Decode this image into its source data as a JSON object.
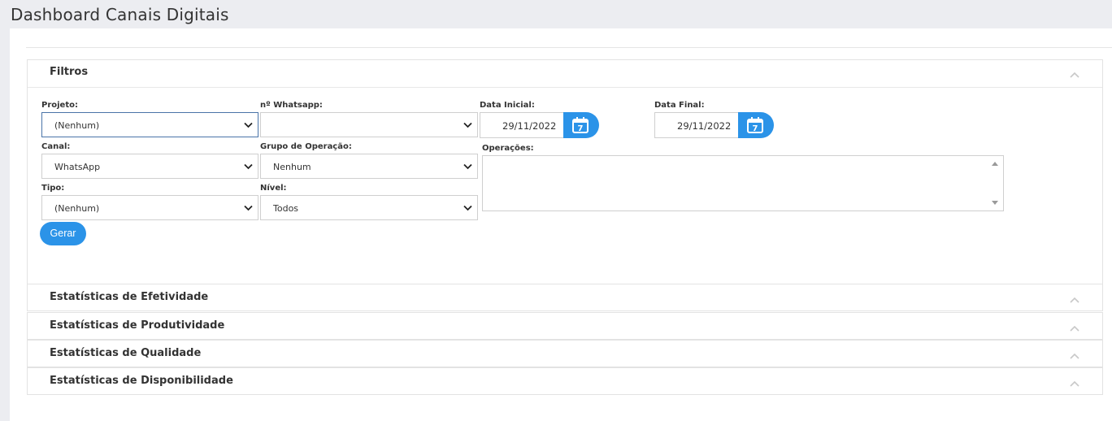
{
  "page": {
    "title": "Dashboard Canais Digitais"
  },
  "filtros": {
    "title": "Filtros",
    "projeto": {
      "label": "Projeto:",
      "value": "(Nenhum)"
    },
    "whatsapp": {
      "label": "nº Whatsapp:",
      "value": ""
    },
    "data_inicial": {
      "label": "Data Inicial:",
      "value": "29/11/2022",
      "icon": "calendar-icon"
    },
    "data_final": {
      "label": "Data Final:",
      "value": "29/11/2022",
      "icon": "calendar-icon"
    },
    "canal": {
      "label": "Canal:",
      "value": "WhatsApp"
    },
    "grupo": {
      "label": "Grupo de Operação:",
      "value": "Nenhum"
    },
    "operacoes": {
      "label": "Operações:"
    },
    "tipo": {
      "label": "Tipo:",
      "value": "(Nenhum)"
    },
    "nivel": {
      "label": "Nível:",
      "value": "Todos"
    },
    "gerar_label": "Gerar"
  },
  "sections": {
    "efetividade": "Estatísticas de Efetividade",
    "produtividade": "Estatísticas de Produtividade",
    "qualidade": "Estatísticas de Qualidade",
    "disponibilidade": "Estatísticas de Disponibilidade"
  },
  "colors": {
    "accent": "#2b93e8",
    "active_border": "#4a74a8"
  }
}
